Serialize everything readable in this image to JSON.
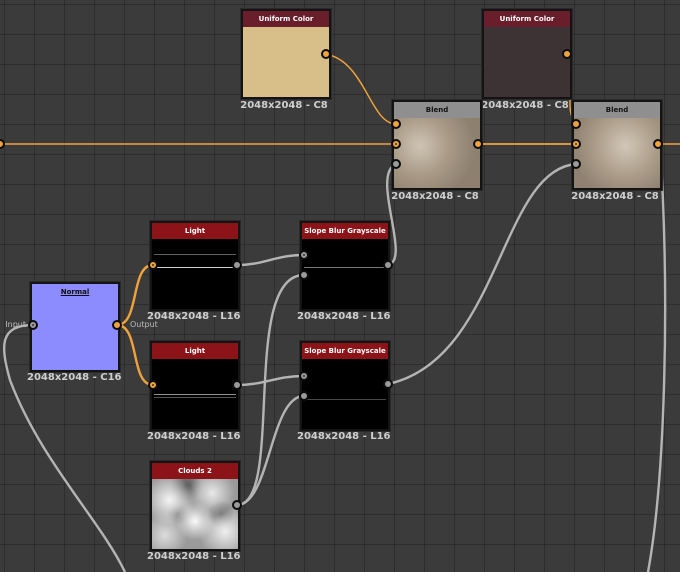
{
  "colors": {
    "canvas": "#3b3b3b",
    "wire_orange": "#f0a33c",
    "wire_grey": "#b4b4b4",
    "header_red": "#8c1418",
    "header_maroon": "#6a1d2a",
    "header_grey": "#8f8f8f",
    "normal_purple": "#8c8cff"
  },
  "nodes": {
    "uniform_color_1": {
      "title": "Uniform Color",
      "resolution": "2048x2048 - C8",
      "swatch": "#d8bf8a"
    },
    "uniform_color_2": {
      "title": "Uniform Color",
      "resolution": "2048x2048 - C8",
      "swatch": "#3d3335"
    },
    "blend_1": {
      "title": "Blend",
      "resolution": "2048x2048 - C8"
    },
    "blend_2": {
      "title": "Blend",
      "resolution": "2048x2048 - C8"
    },
    "normal": {
      "title": "Normal",
      "resolution": "2048x2048 - C16",
      "input_label": "Input",
      "output_label": "Output"
    },
    "light_1": {
      "title": "Light",
      "resolution": "2048x2048 - L16"
    },
    "light_2": {
      "title": "Light",
      "resolution": "2048x2048 - L16"
    },
    "slope_blur_1": {
      "title": "Slope Blur Grayscale",
      "resolution": "2048x2048 - L16"
    },
    "slope_blur_2": {
      "title": "Slope Blur Grayscale",
      "resolution": "2048x2048 - L16"
    },
    "clouds_2": {
      "title": "Clouds 2",
      "resolution": "2048x2048 - L16"
    }
  }
}
